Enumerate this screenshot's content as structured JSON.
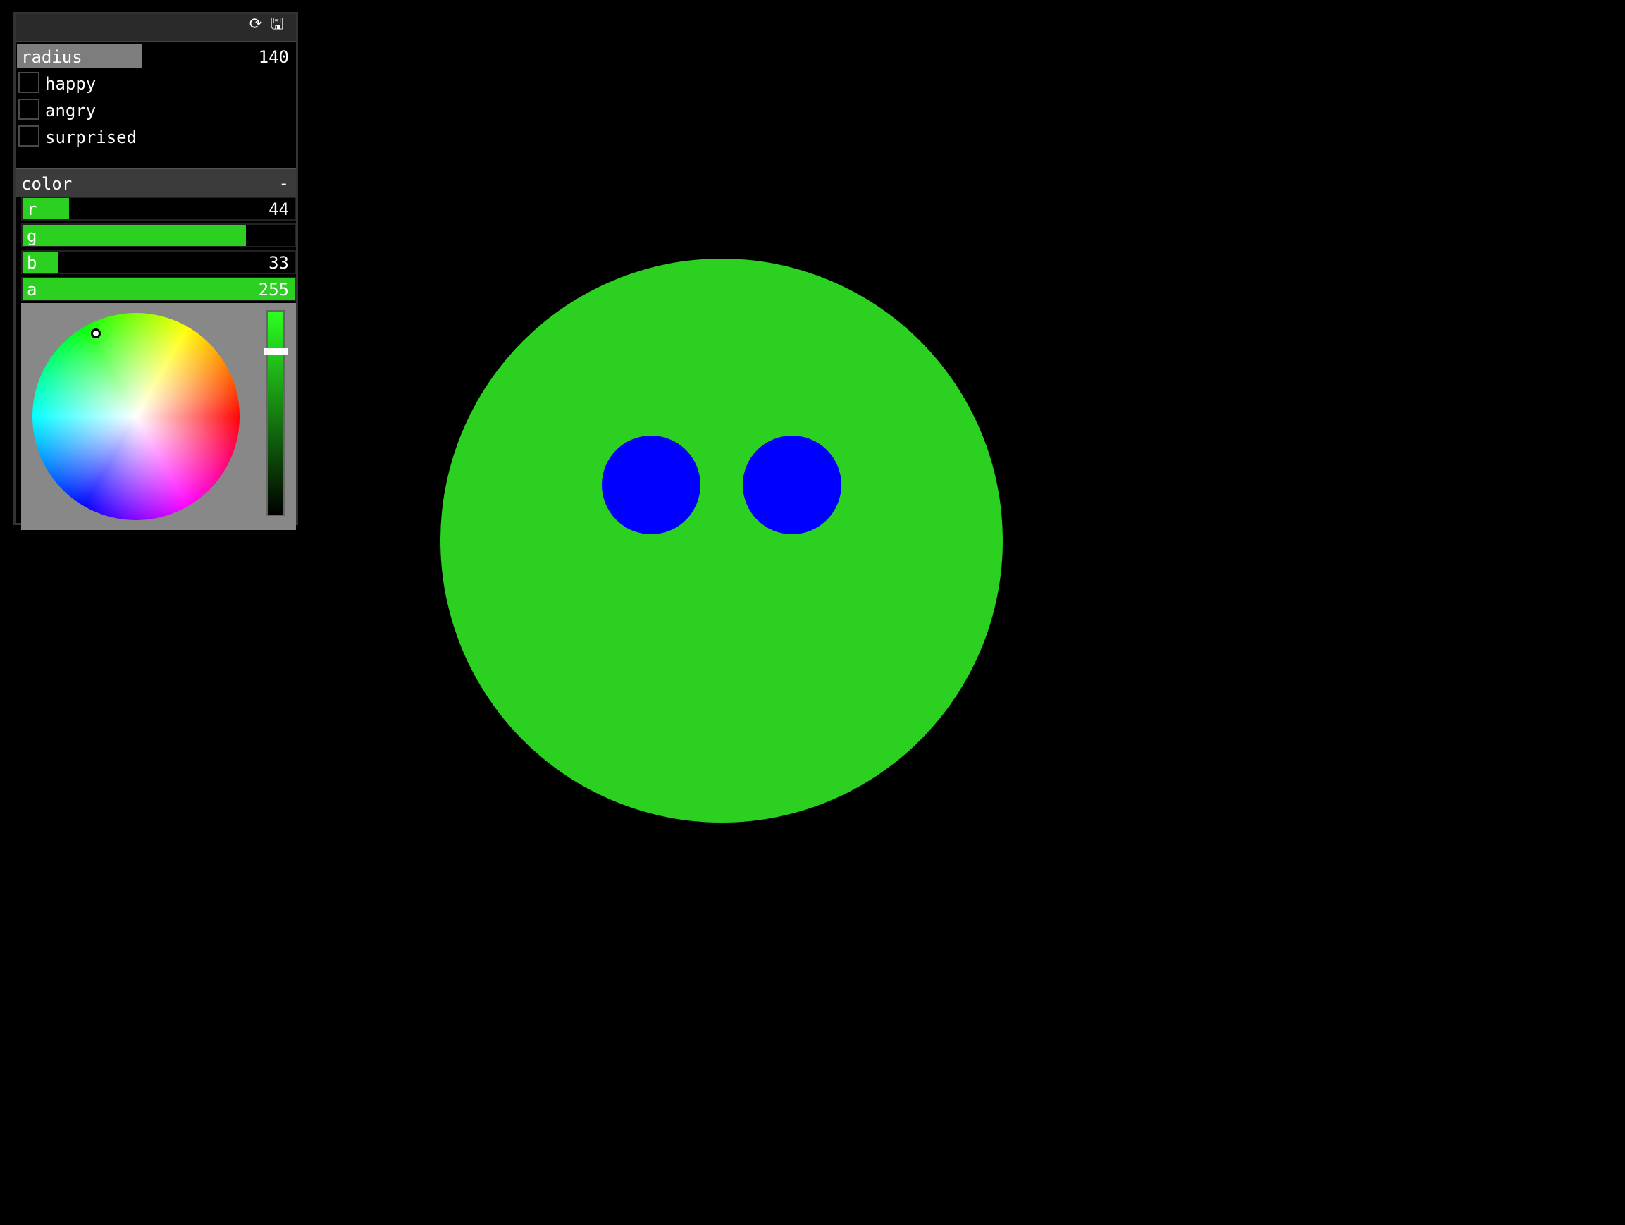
{
  "toolbar": {
    "refresh_icon": "refresh-icon",
    "save_icon": "save-icon"
  },
  "controls": {
    "radius": {
      "label": "radius",
      "value": "140",
      "level": 0.45
    },
    "toggles": [
      {
        "label": "happy",
        "checked": false
      },
      {
        "label": "angry",
        "checked": false
      },
      {
        "label": "surprised",
        "checked": false
      }
    ]
  },
  "color_group": {
    "title": "color",
    "collapse_symbol": "-",
    "sliders": [
      {
        "label": "r",
        "value": "44",
        "level": 0.17
      },
      {
        "label": "g",
        "value": "",
        "level": 0.82
      },
      {
        "label": "b",
        "value": "33",
        "level": 0.13
      },
      {
        "label": "a",
        "value": "255",
        "level": 1.0
      }
    ],
    "picker": {
      "selected_color": "#2cd021",
      "brightness_level": 0.82
    }
  },
  "scene": {
    "face_color": "#2cd021",
    "eye_color": "#0000ff",
    "background_color": "#000000"
  }
}
